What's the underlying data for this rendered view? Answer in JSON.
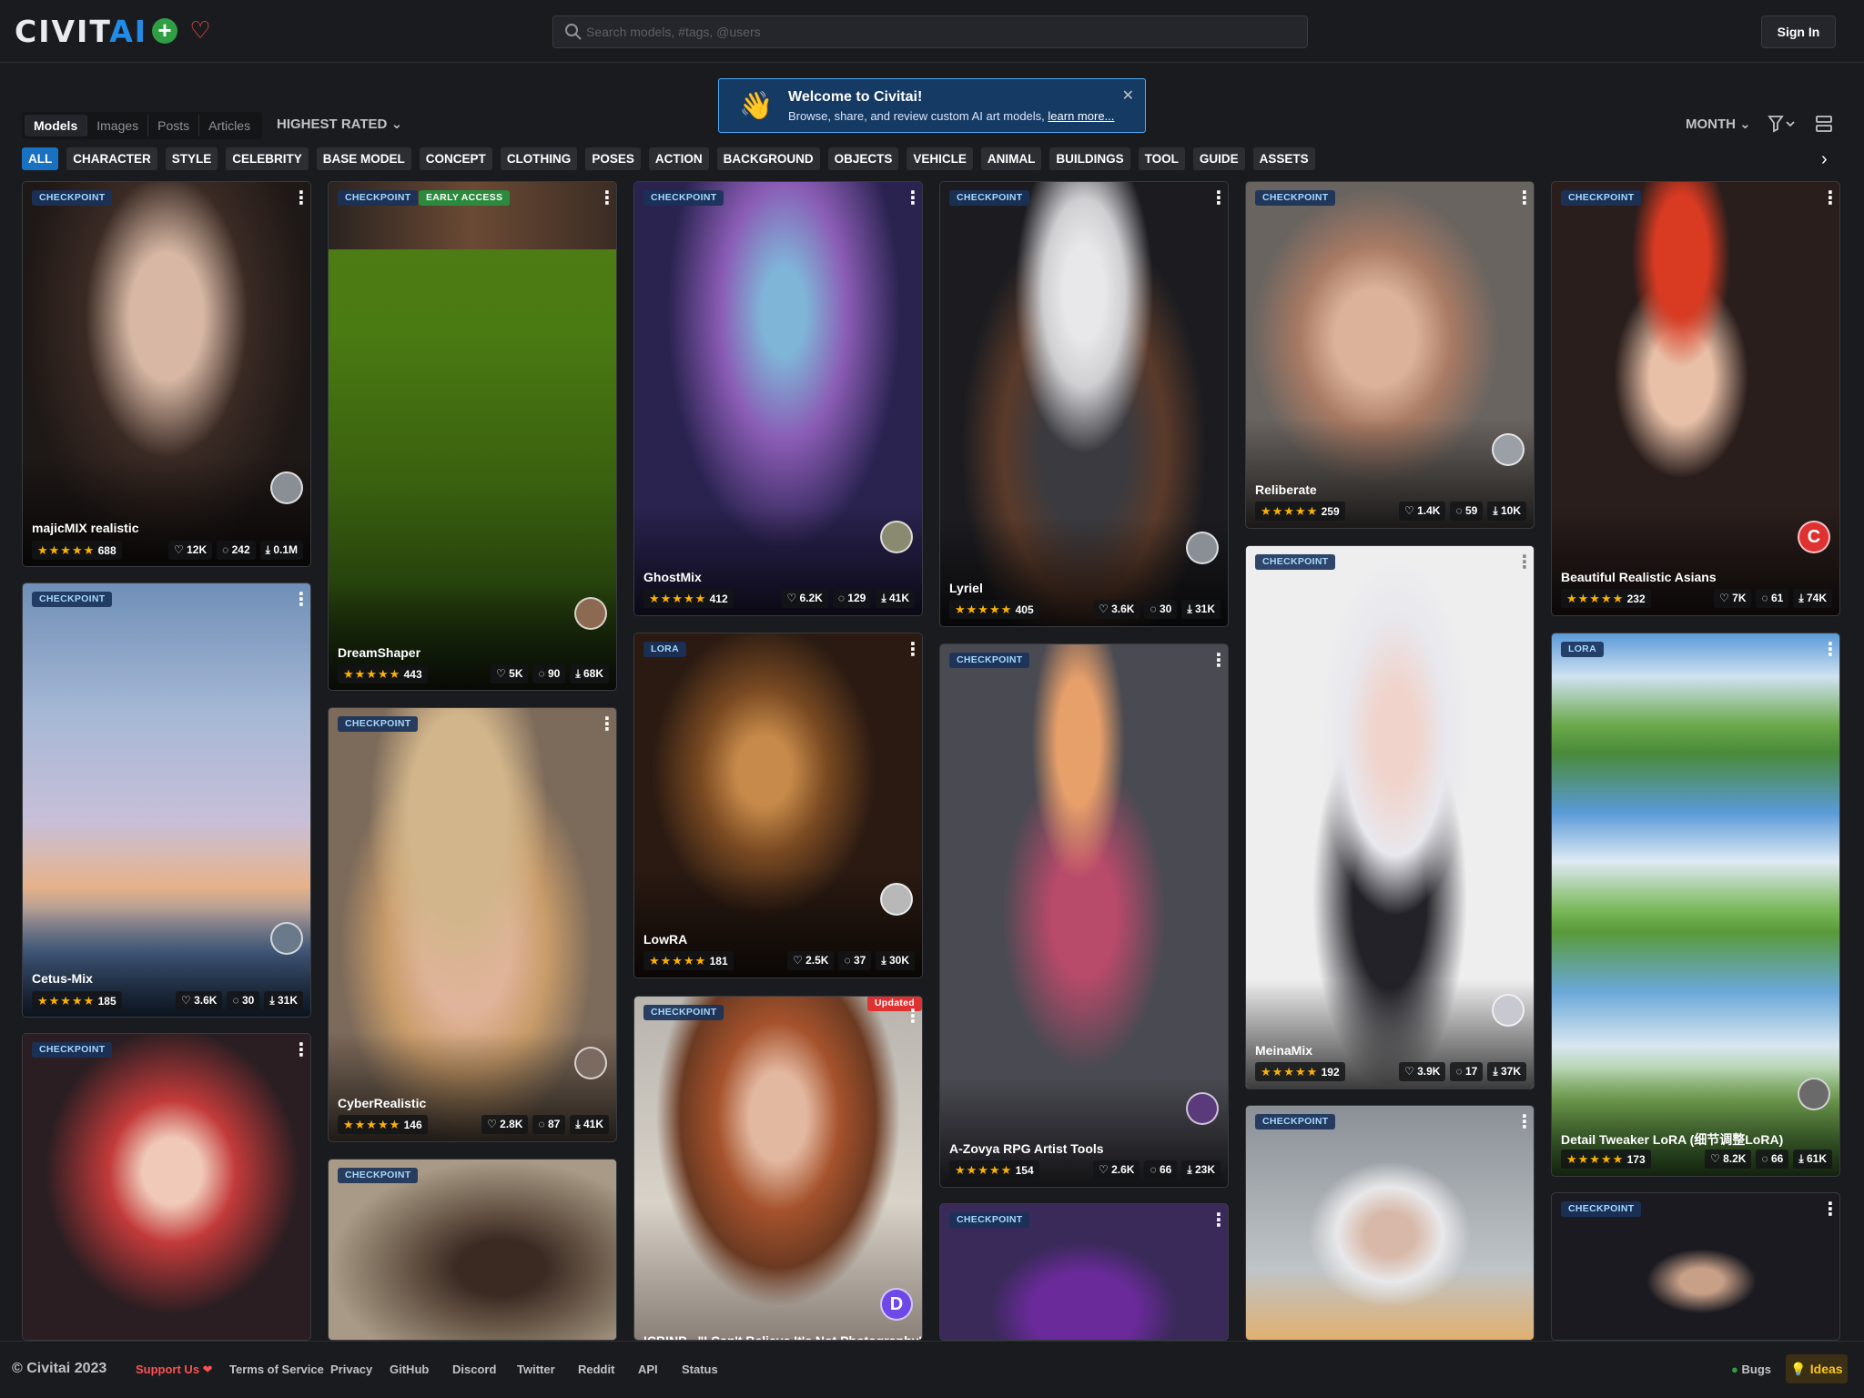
{
  "header": {
    "logo_main": "CIVIT",
    "logo_ai": "AI",
    "search_placeholder": "Search models, #tags, @users",
    "signin_label": "Sign In"
  },
  "welcome": {
    "title": "Welcome to Civitai!",
    "text": "Browse, share, and review custom AI art models, ",
    "link": "learn more..."
  },
  "toolbar": {
    "segments": [
      "Models",
      "Images",
      "Posts",
      "Articles"
    ],
    "sort_label": "HIGHEST RATED",
    "period_label": "MONTH"
  },
  "tags": [
    "ALL",
    "CHARACTER",
    "STYLE",
    "CELEBRITY",
    "BASE MODEL",
    "CONCEPT",
    "CLOTHING",
    "POSES",
    "ACTION",
    "BACKGROUND",
    "OBJECTS",
    "VEHICLE",
    "ANIMAL",
    "BUILDINGS",
    "TOOL",
    "GUIDE",
    "ASSETS"
  ],
  "cards": [
    {
      "title": "majicMIX realistic",
      "type": "CHECKPOINT",
      "rating": "688",
      "likes": "12K",
      "comments": "242",
      "downloads": "0.1M"
    },
    {
      "title": "Cetus-Mix",
      "type": "CHECKPOINT",
      "rating": "185",
      "likes": "3.6K",
      "comments": "30",
      "downloads": "31K"
    },
    {
      "title": "",
      "type": "CHECKPOINT"
    },
    {
      "title": "DreamShaper",
      "type": "CHECKPOINT",
      "extra_badge": "EARLY ACCESS",
      "rating": "443",
      "likes": "5K",
      "comments": "90",
      "downloads": "68K"
    },
    {
      "title": "CyberRealistic",
      "type": "CHECKPOINT",
      "rating": "146",
      "likes": "2.8K",
      "comments": "87",
      "downloads": "41K"
    },
    {
      "title": "",
      "type": "CHECKPOINT"
    },
    {
      "title": "GhostMix",
      "type": "CHECKPOINT",
      "rating": "412",
      "likes": "6.2K",
      "comments": "129",
      "downloads": "41K"
    },
    {
      "title": "LowRA",
      "type": "LORA",
      "rating": "181",
      "likes": "2.5K",
      "comments": "37",
      "downloads": "30K"
    },
    {
      "title": "ICBINP - \"I Can't Believe It's Not Photography\"",
      "type": "CHECKPOINT",
      "extra_badge": "Updated",
      "avatar_letter": "D"
    },
    {
      "title": "Lyriel",
      "type": "CHECKPOINT",
      "rating": "405",
      "likes": "3.6K",
      "comments": "30",
      "downloads": "31K"
    },
    {
      "title": "A-Zovya RPG Artist Tools",
      "type": "CHECKPOINT",
      "rating": "154",
      "likes": "2.6K",
      "comments": "66",
      "downloads": "23K"
    },
    {
      "title": "",
      "type": "CHECKPOINT"
    },
    {
      "title": "Reliberate",
      "type": "CHECKPOINT",
      "rating": "259",
      "likes": "1.4K",
      "comments": "59",
      "downloads": "10K"
    },
    {
      "title": "MeinaMix",
      "type": "CHECKPOINT",
      "rating": "192",
      "likes": "3.9K",
      "comments": "17",
      "downloads": "37K"
    },
    {
      "title": "",
      "type": "CHECKPOINT"
    },
    {
      "title": "Beautiful Realistic Asians",
      "type": "CHECKPOINT",
      "rating": "232",
      "likes": "7K",
      "comments": "61",
      "downloads": "74K",
      "avatar_letter": "C"
    },
    {
      "title": "Detail Tweaker LoRA (细节调整LoRA)",
      "type": "LORA",
      "rating": "173",
      "likes": "8.2K",
      "comments": "66",
      "downloads": "61K"
    },
    {
      "title": "",
      "type": "CHECKPOINT"
    }
  ],
  "stars": "★★★★★",
  "footer": {
    "copyright": "© Civitai 2023",
    "support": "Support Us ❤",
    "links": [
      "Terms of Service",
      "Privacy",
      "GitHub",
      "Discord",
      "Twitter",
      "Reddit",
      "API",
      "Status"
    ],
    "bugs": "Bugs",
    "ideas": "Ideas"
  },
  "colors": {
    "background": "#1a1b1e",
    "card": "#25262b",
    "accent": "#1971c2",
    "star": "#fab005",
    "support": "#fa5252"
  }
}
